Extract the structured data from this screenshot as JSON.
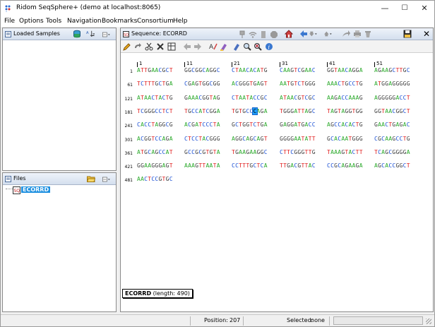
{
  "window": {
    "title": "Ridom SeqSphere+ (demo at localhost:8065)",
    "minimize": "—",
    "maximize": "☐",
    "close": "✕"
  },
  "menu": [
    "File",
    "Options",
    "Tools",
    "Navigation",
    "Bookmarks",
    "Consortium",
    "Help"
  ],
  "loaded_samples": {
    "title": "Loaded Samples",
    "sort_label": "z"
  },
  "files": {
    "title": "Files",
    "item": "ECORRD"
  },
  "sequence": {
    "title": "Sequence: ECORRD"
  },
  "ruler": [
    "1",
    "11",
    "21",
    "31",
    "41",
    "51"
  ],
  "rows": [
    {
      "num": "1",
      "blocks": [
        "ATTGAACGCT",
        "GGCGGCAGGC",
        "CTAACACATG",
        "CAAGTCGAAC",
        "GGTAACAGGA",
        "AGAAGCTTGC"
      ]
    },
    {
      "num": "61",
      "blocks": [
        "TCTTTGCTGA",
        "CGAGTGGCGG",
        "ACGGGTGAGT",
        "AATGTCTGGG",
        "AAACTGCCTG",
        "ATGGAGGGGG"
      ]
    },
    {
      "num": "121",
      "blocks": [
        "ATAACTACTG",
        "GAAACGGTAG",
        "CTAATACCGC",
        "ATAACGTCGC",
        "AAGACCAAAG",
        "AGGGGGACCT"
      ]
    },
    {
      "num": "181",
      "blocks": [
        "TCGGGCCTCT",
        "TGCCATCGGA",
        "TGTGCCCAGA",
        "TGGGATTAGC",
        "TAGTAGGTGG",
        "GGTAACGGCT"
      ]
    },
    {
      "num": "241",
      "blocks": [
        "CACCTAGGCG",
        "ACGATCCCTA",
        "GCTGGTCTGA",
        "GAGGATGACC",
        "AGCCACACTG",
        "GAACTGAGAC"
      ]
    },
    {
      "num": "301",
      "blocks": [
        "ACGGTCCAGA",
        "CTCCTACGGG",
        "AGGCAGCAGT",
        "GGGGAATATT",
        "GCACAATGGG",
        "CGCAAGCCTG"
      ]
    },
    {
      "num": "361",
      "blocks": [
        "ATGCAGCCAT",
        "GCCGCGTGTA",
        "TGAAGAAGGC",
        "CTTCGGGTTG",
        "TAAAGTACTT",
        "TCAGCGGGGA"
      ]
    },
    {
      "num": "421",
      "blocks": [
        "GGAAGGGAGT",
        "AAAGTTAATA",
        "CCTTTGCTCA",
        "TTGACGTTAC",
        "CCGCAGAAGA",
        "AGCACCGGCT"
      ]
    },
    {
      "num": "481",
      "blocks": [
        "AACTCCGTGC"
      ]
    }
  ],
  "cursor": {
    "row": 3,
    "block": 2,
    "index": 6
  },
  "info": {
    "name": "ECORRD",
    "detail": " (length: 490)"
  },
  "status": {
    "position_label": "Position:",
    "position_value": "207",
    "selected_label": "Selected:",
    "selected_value": "none"
  }
}
